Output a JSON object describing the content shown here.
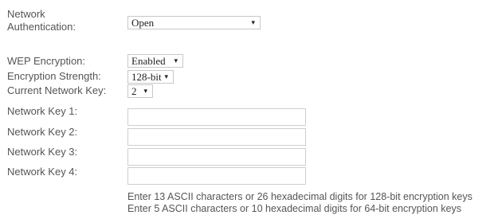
{
  "network_auth": {
    "label": "Network Authentication:",
    "value": "Open"
  },
  "wep_encryption": {
    "label": "WEP Encryption:",
    "value": "Enabled"
  },
  "encryption_strength": {
    "label": "Encryption Strength:",
    "value": "128-bit"
  },
  "current_key": {
    "label": "Current Network Key:",
    "value": "2"
  },
  "keys": [
    {
      "label": "Network Key 1:",
      "value": ""
    },
    {
      "label": "Network Key 2:",
      "value": ""
    },
    {
      "label": "Network Key 3:",
      "value": ""
    },
    {
      "label": "Network Key 4:",
      "value": ""
    }
  ],
  "hints": [
    "Enter 13 ASCII characters or 26 hexadecimal digits for 128-bit encryption keys",
    "Enter 5 ASCII characters or 10 hexadecimal digits for 64-bit encryption keys"
  ],
  "icons": {
    "dropdown_arrow": "▾"
  }
}
